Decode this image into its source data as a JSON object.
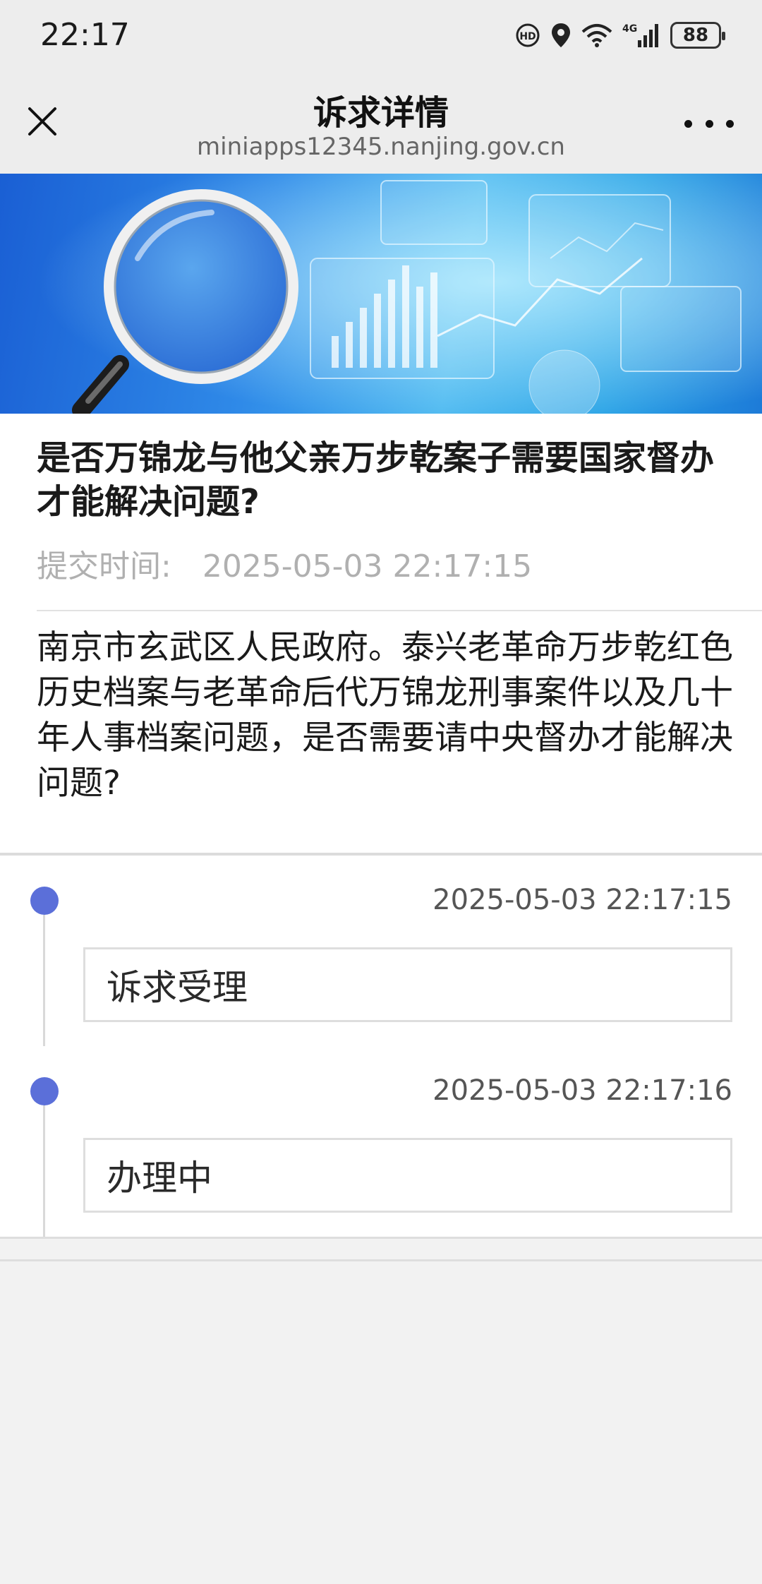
{
  "status_bar": {
    "time": "22:17",
    "battery": "88",
    "network": "4G",
    "icons": [
      "hd-call-icon",
      "location-icon",
      "wifi-icon",
      "signal-icon",
      "battery-icon"
    ]
  },
  "nav": {
    "title": "诉求详情",
    "subtitle": "miniapps12345.nanjing.gov.cn",
    "close_icon": "close-icon",
    "more_icon": "more-icon"
  },
  "banner": {
    "image": "magnifier-data-analysis-banner"
  },
  "case": {
    "title": "是否万锦龙与他父亲万步乾案子需要国家督办才能解决问题?",
    "submit_label": "提交时间:",
    "submit_time": "2025-05-03 22:17:15",
    "content": "南京市玄武区人民政府。泰兴老革命万步乾红色历史档案与老革命后代万锦龙刑事案件以及几十年人事档案问题，是否需要请中央督办才能解决问题?"
  },
  "timeline": [
    {
      "time": "2025-05-03 22:17:15",
      "status": "诉求受理"
    },
    {
      "time": "2025-05-03 22:17:16",
      "status": "办理中"
    }
  ],
  "colors": {
    "accent_dot": "#5b6fd9",
    "background": "#f2f2f2",
    "muted_text": "#b0b0b0"
  }
}
